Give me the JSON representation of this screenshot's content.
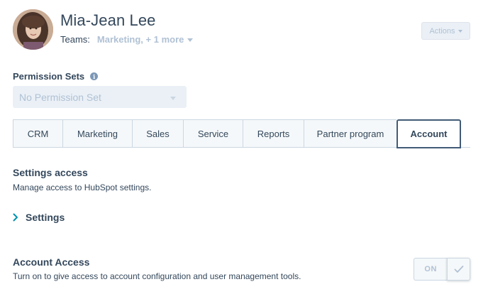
{
  "user": {
    "name": "Mia-Jean Lee",
    "teams_label": "Teams:",
    "teams_value": "Marketing, + 1 more"
  },
  "header": {
    "actions_label": "Actions"
  },
  "permissions": {
    "label": "Permission Sets",
    "select_value": "No Permission Set"
  },
  "tabs": [
    {
      "label": "CRM",
      "active": false
    },
    {
      "label": "Marketing",
      "active": false
    },
    {
      "label": "Sales",
      "active": false
    },
    {
      "label": "Service",
      "active": false
    },
    {
      "label": "Reports",
      "active": false
    },
    {
      "label": "Partner program",
      "active": false
    },
    {
      "label": "Account",
      "active": true
    }
  ],
  "settings_access": {
    "title": "Settings access",
    "description": "Manage access to HubSpot settings.",
    "expand_label": "Settings"
  },
  "account_access": {
    "title": "Account Access",
    "description": "Turn on to give access to account configuration and user management tools.",
    "toggle_label": "ON"
  },
  "icons": {
    "info": "info-icon",
    "chevron": "chevron-right-icon",
    "check": "check-icon",
    "caret": "caret-down-icon"
  },
  "colors": {
    "text": "#33475b",
    "muted": "#b0c1d4",
    "accent": "#0091ae",
    "active_tab_border": "#425b76",
    "border": "#cbd6e2"
  }
}
